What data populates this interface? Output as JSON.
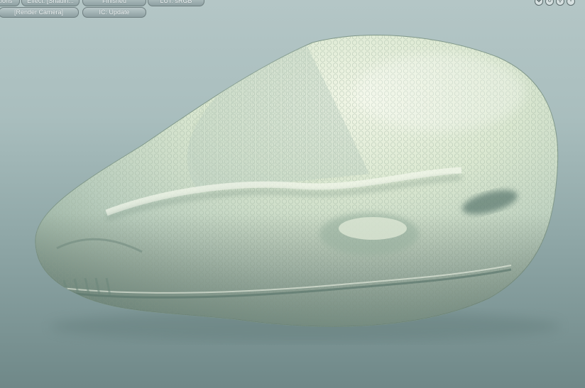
{
  "toolbar": {
    "row1": [
      {
        "id": "options",
        "label": "tions"
      },
      {
        "id": "effect",
        "label": "Effect: [Shadin..."
      },
      {
        "id": "finished",
        "label": "Finished"
      },
      {
        "id": "lut",
        "label": "LUT: sRGB"
      }
    ],
    "row2": [
      {
        "id": "camera",
        "label": "[Render Camera]"
      },
      {
        "id": "ic",
        "label": "IC: Update"
      }
    ]
  },
  "nav_icons": [
    {
      "name": "move-icon",
      "glyph": "✥"
    },
    {
      "name": "rotate-icon",
      "glyph": "↻"
    },
    {
      "name": "zoom-icon",
      "glyph": "⚲"
    },
    {
      "name": "frame-icon",
      "glyph": "▫"
    }
  ],
  "colors": {
    "background_top": "#b4c6c6",
    "background_bottom": "#6f8888",
    "model_skin": "#dbe8d1",
    "model_shadow": "#8fa89a"
  }
}
